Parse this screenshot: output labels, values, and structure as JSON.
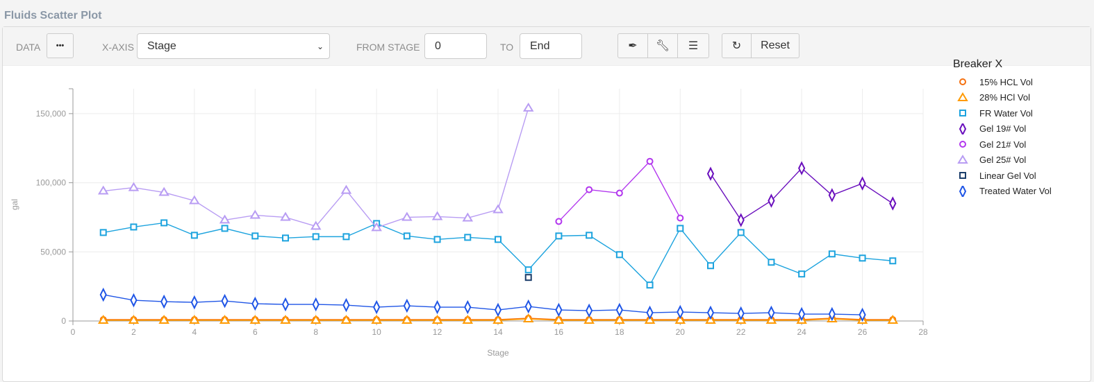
{
  "header": {
    "title": "Fluids Scatter Plot"
  },
  "toolbar": {
    "data_label": "DATA",
    "data_button": "•••",
    "xaxis_label": "X-AXIS",
    "xaxis_value": "Stage",
    "from_label": "FROM STAGE",
    "from_value": "0",
    "to_label": "TO",
    "to_value": "End",
    "reset_label": "Reset"
  },
  "icons": [
    "eyedropper-icon",
    "wrench-icon",
    "list-icon",
    "refresh-icon",
    "chevron-down-icon"
  ],
  "chart_data": {
    "type": "line",
    "title": "",
    "xlabel": "Stage",
    "ylabel": "gal",
    "xlim": [
      0,
      28
    ],
    "ylim": [
      0,
      168000
    ],
    "xticks": [
      "0",
      "2",
      "4",
      "6",
      "8",
      "10",
      "12",
      "14",
      "16",
      "18",
      "20",
      "22",
      "24",
      "26",
      "28"
    ],
    "yticks": [
      "0",
      "50,000",
      "100,000",
      "150,000"
    ],
    "ytick_values": [
      0,
      50000,
      100000,
      150000
    ],
    "xtick_values": [
      0,
      2,
      4,
      6,
      8,
      10,
      12,
      14,
      16,
      18,
      20,
      22,
      24,
      26,
      28
    ],
    "grid": true,
    "legend": {
      "title": "Breaker X",
      "placement": "right"
    },
    "series": [
      {
        "name": "15% HCL Vol",
        "color": "#f5700f",
        "marker": "circle",
        "x": [
          1,
          2,
          3,
          4,
          5,
          6,
          7,
          8,
          9,
          10,
          11,
          12,
          13,
          14,
          15,
          16,
          17,
          18,
          19,
          20,
          21,
          22,
          23,
          24,
          25,
          26,
          27
        ],
        "y": [
          1000,
          1000,
          1000,
          1000,
          1000,
          1000,
          1000,
          1000,
          1000,
          1000,
          1000,
          1000,
          1000,
          1000,
          2000,
          1000,
          1000,
          1000,
          1000,
          1000,
          1000,
          1000,
          1000,
          1000,
          2000,
          1000,
          1000
        ]
      },
      {
        "name": "28% HCl Vol",
        "color": "#ff9a00",
        "marker": "triangle",
        "x": [
          1,
          2,
          3,
          4,
          5,
          6,
          7,
          8,
          9,
          10,
          11,
          12,
          13,
          14,
          15,
          16,
          17,
          18,
          19,
          20,
          21,
          22,
          23,
          24,
          25,
          26,
          27
        ],
        "y": [
          500,
          500,
          500,
          500,
          500,
          500,
          500,
          500,
          500,
          500,
          500,
          500,
          500,
          500,
          1500,
          500,
          500,
          500,
          500,
          500,
          500,
          500,
          500,
          500,
          1500,
          500,
          500
        ]
      },
      {
        "name": "FR Water Vol",
        "color": "#1ca3de",
        "marker": "square",
        "x": [
          1,
          2,
          3,
          4,
          5,
          6,
          7,
          8,
          9,
          10,
          11,
          12,
          13,
          14,
          15,
          16,
          17,
          18,
          19,
          20,
          21,
          22,
          23,
          24,
          25,
          26,
          27
        ],
        "y": [
          64000,
          68000,
          71000,
          62000,
          67000,
          61500,
          60000,
          61000,
          61000,
          70500,
          61500,
          59000,
          60500,
          59000,
          37000,
          61500,
          62000,
          48000,
          26000,
          67000,
          40000,
          64000,
          42500,
          34000,
          48500,
          45500,
          43500
        ]
      },
      {
        "name": "Gel 19# Vol",
        "color": "#6a0fbd",
        "marker": "diamond",
        "x": [
          21,
          22,
          23,
          24,
          25,
          26,
          27
        ],
        "y": [
          106500,
          73000,
          87000,
          110500,
          91000,
          99500,
          85000
        ]
      },
      {
        "name": "Gel 21# Vol",
        "color": "#b236ee",
        "marker": "circle",
        "x": [
          16,
          17,
          18,
          19,
          20
        ],
        "y": [
          72000,
          95000,
          92500,
          115500,
          74500
        ]
      },
      {
        "name": "Gel 25# Vol",
        "color": "#b89cf3",
        "marker": "triangle",
        "x": [
          1,
          2,
          3,
          4,
          5,
          6,
          7,
          8,
          9,
          10,
          11,
          12,
          13,
          14,
          15
        ],
        "y": [
          94000,
          96500,
          93000,
          87000,
          73000,
          76500,
          75000,
          68500,
          94500,
          67500,
          75000,
          75500,
          74500,
          80500,
          154000
        ]
      },
      {
        "name": "Linear Gel Vol",
        "color": "#1b3d6a",
        "marker": "square",
        "x": [
          15
        ],
        "y": [
          31500
        ]
      },
      {
        "name": "Treated Water Vol",
        "color": "#1f55e6",
        "marker": "diamond",
        "x": [
          1,
          2,
          3,
          4,
          5,
          6,
          7,
          8,
          9,
          10,
          11,
          12,
          13,
          14,
          15,
          16,
          17,
          18,
          19,
          20,
          21,
          22,
          23,
          24,
          25,
          26
        ],
        "y": [
          19000,
          15000,
          14000,
          13500,
          14500,
          12500,
          12000,
          12000,
          11500,
          10000,
          11000,
          10000,
          10000,
          8000,
          10500,
          8000,
          7500,
          8000,
          6000,
          6500,
          6000,
          5500,
          6000,
          5000,
          5000,
          4500
        ]
      }
    ]
  }
}
